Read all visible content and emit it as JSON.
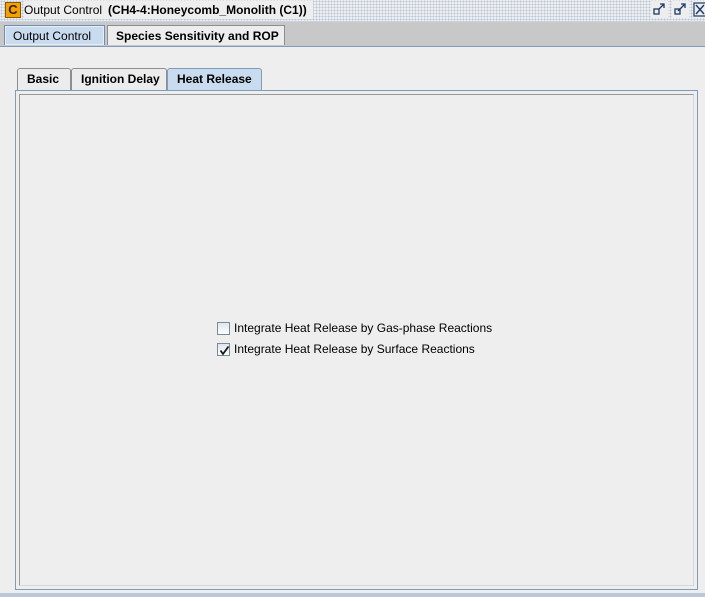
{
  "window": {
    "title": "Output Control",
    "subtitle": "(CH4-4:Honeycomb_Monolith (C1))",
    "app_icon_glyph": "C"
  },
  "top_tabs": [
    {
      "label": "Output Control",
      "selected": true
    },
    {
      "label": "Species Sensitivity and ROP",
      "selected": false
    }
  ],
  "inner_tabs": [
    {
      "label": "Basic",
      "selected": false
    },
    {
      "label": "Ignition Delay",
      "selected": false
    },
    {
      "label": "Heat Release",
      "selected": true
    }
  ],
  "options": [
    {
      "label": "Integrate Heat Release by Gas-phase Reactions",
      "checked": false
    },
    {
      "label": "Integrate Heat Release by Surface Reactions",
      "checked": true
    }
  ],
  "colors": {
    "selected_tab": "#c9dbef",
    "border_blue": "#7f9db9",
    "icon_orange": "#f2a100"
  }
}
